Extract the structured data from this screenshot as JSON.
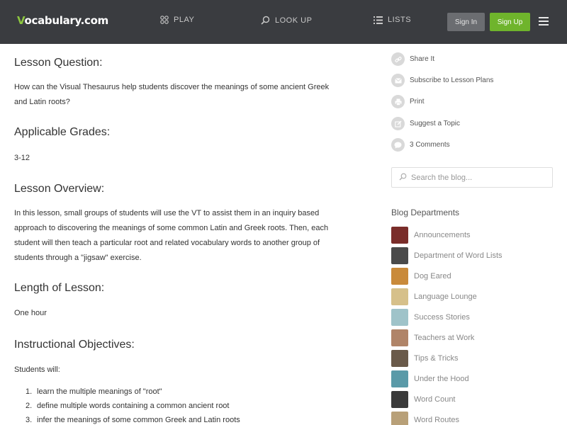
{
  "header": {
    "logo_v": "V",
    "logo_rest": "ocabulary.com",
    "nav": {
      "play": "PLAY",
      "lookup": "LOOK UP",
      "lists": "LISTS"
    },
    "sign_in": "Sign In",
    "sign_up": "Sign Up"
  },
  "main": {
    "lesson_question_heading": "Lesson Question:",
    "lesson_question_text_line1": "How can the Visual Thesaurus help students discover the meanings of some ancient Greek",
    "lesson_question_text_line2": "and Latin roots?",
    "grades_heading": "Applicable Grades:",
    "grades_text": "3-12",
    "overview_heading": "Lesson Overview:",
    "overview_line1": "In this lesson, small groups of students will use the VT to assist them in an inquiry based",
    "overview_line2": "approach to discovering the meanings of some common Latin and Greek roots. Then, each",
    "overview_line3": "student will then teach a particular root and related vocabulary words to another group of",
    "overview_line4": "students through a \"jigsaw\" exercise.",
    "length_heading": "Length of Lesson:",
    "length_text": "One hour",
    "objectives_heading": "Instructional Objectives:",
    "objectives_intro": "Students will:",
    "objectives": [
      {
        "num": "1.",
        "text": "learn the multiple meanings of \"root\""
      },
      {
        "num": "2.",
        "text": "define multiple words containing a common ancient root"
      },
      {
        "num": "3.",
        "text": "infer the meanings of some common Greek and Latin roots"
      }
    ]
  },
  "sidebar": {
    "actions": {
      "share": "Share It",
      "subscribe": "Subscribe to Lesson Plans",
      "print": "Print",
      "suggest": "Suggest a Topic",
      "comments": "3 Comments"
    },
    "search_placeholder": "Search the blog...",
    "departments_title": "Blog Departments",
    "departments": [
      {
        "label": "Announcements",
        "color": "#7a2d2a"
      },
      {
        "label": "Department of Word Lists",
        "color": "#4a4a4a"
      },
      {
        "label": "Dog Eared",
        "color": "#c98a3a"
      },
      {
        "label": "Language Lounge",
        "color": "#d6c08a"
      },
      {
        "label": "Success Stories",
        "color": "#9fc3c9"
      },
      {
        "label": "Teachers at Work",
        "color": "#b08468"
      },
      {
        "label": "Tips & Tricks",
        "color": "#6a5a4a"
      },
      {
        "label": "Under the Hood",
        "color": "#5a9aa8"
      },
      {
        "label": "Word Count",
        "color": "#3a3a3a"
      },
      {
        "label": "Word Routes",
        "color": "#b8a078"
      }
    ]
  },
  "colors": {
    "header_bg": "#3a3c40",
    "accent_green": "#6fb42c",
    "logo_green": "#8cc63f"
  }
}
